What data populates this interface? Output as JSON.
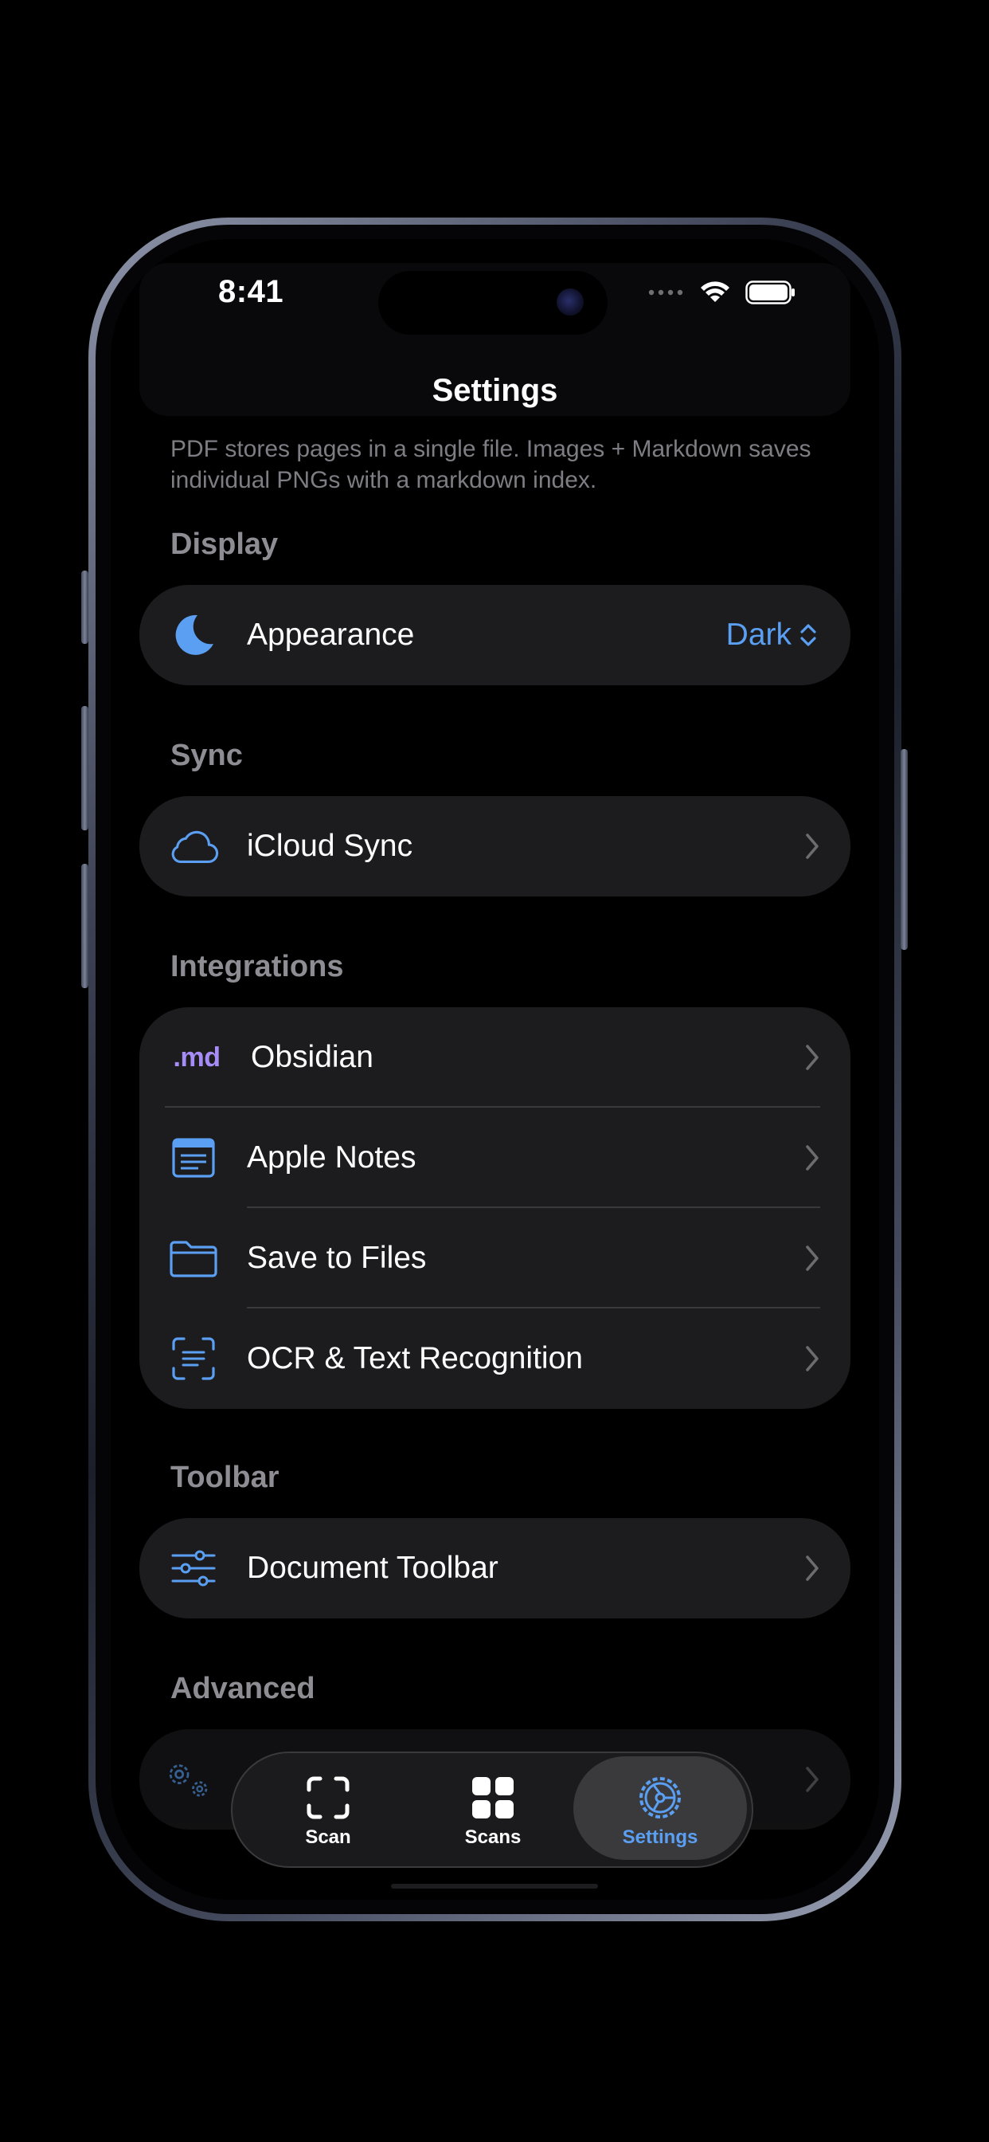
{
  "status_bar": {
    "time": "8:41"
  },
  "nav": {
    "title": "Settings"
  },
  "storage_footnote": "PDF stores pages in a single file. Images + Markdown saves individual PNGs with a markdown index.",
  "sections": {
    "display": {
      "header": "Display",
      "appearance": {
        "label": "Appearance",
        "value": "Dark",
        "icon": "moon-icon"
      }
    },
    "sync": {
      "header": "Sync",
      "icloud": {
        "label": "iCloud Sync",
        "icon": "cloud-icon"
      }
    },
    "integrations": {
      "header": "Integrations",
      "obsidian": {
        "label": "Obsidian",
        "badge": ".md"
      },
      "apple_notes": {
        "label": "Apple Notes",
        "icon": "notes-icon"
      },
      "save_files": {
        "label": "Save to Files",
        "icon": "folder-icon"
      },
      "ocr": {
        "label": "OCR & Text Recognition",
        "icon": "text-scan-icon"
      }
    },
    "toolbar": {
      "header": "Toolbar",
      "document_toolbar": {
        "label": "Document Toolbar",
        "icon": "sliders-icon"
      }
    },
    "advanced": {
      "header": "Advanced",
      "icon": "gears-icon"
    }
  },
  "tab_bar": {
    "scan": "Scan",
    "scans": "Scans",
    "settings": "Settings",
    "active": "settings"
  },
  "colors": {
    "accent": "#5b9ff3",
    "obsidian_badge": "#a58cf7",
    "card": "#1c1c1e",
    "background": "#000000"
  }
}
